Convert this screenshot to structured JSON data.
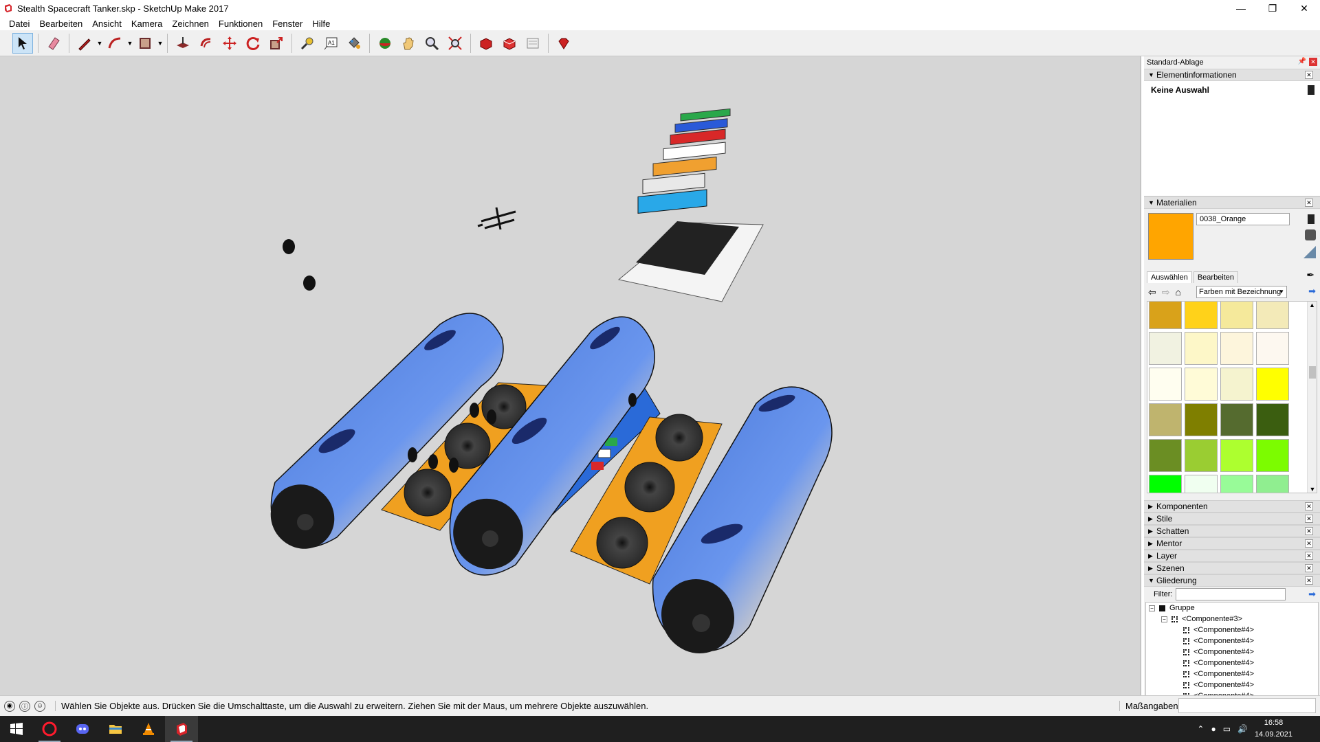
{
  "window": {
    "title": "Stealth Spacecraft Tanker.skp - SketchUp Make 2017",
    "app_icon": "sketchup-icon",
    "controls": {
      "minimize": "—",
      "maximize": "❐",
      "close": "✕"
    }
  },
  "menu": {
    "items": [
      "Datei",
      "Bearbeiten",
      "Ansicht",
      "Kamera",
      "Zeichnen",
      "Funktionen",
      "Fenster",
      "Hilfe"
    ]
  },
  "toolbar": {
    "tools": [
      {
        "name": "select-tool-icon",
        "glyph": "➤",
        "active": true
      },
      {
        "name": "eraser-tool-icon",
        "glyph": "▰"
      },
      {
        "name": "line-tool-icon",
        "glyph": "✎"
      },
      {
        "name": "arc-tool-icon",
        "glyph": "◜"
      },
      {
        "name": "rectangle-tool-icon",
        "glyph": "▭"
      },
      {
        "name": "push-pull-tool-icon",
        "glyph": "⬘"
      },
      {
        "name": "offset-tool-icon",
        "glyph": "↻"
      },
      {
        "name": "move-tool-icon",
        "glyph": "✥"
      },
      {
        "name": "rotate-tool-icon",
        "glyph": "⟳"
      },
      {
        "name": "scale-tool-icon",
        "glyph": "⬕"
      },
      {
        "name": "tape-measure-icon",
        "glyph": "📏"
      },
      {
        "name": "text-tool-icon",
        "glyph": "A"
      },
      {
        "name": "paint-bucket-icon",
        "glyph": "🎨"
      },
      {
        "name": "orbit-tool-icon",
        "glyph": "◔"
      },
      {
        "name": "pan-tool-icon",
        "glyph": "✋"
      },
      {
        "name": "zoom-tool-icon",
        "glyph": "🔍"
      },
      {
        "name": "zoom-extents-icon",
        "glyph": "⤧"
      },
      {
        "name": "warehouse-icon",
        "glyph": "◈"
      },
      {
        "name": "extension-warehouse-icon",
        "glyph": "◆"
      },
      {
        "name": "layout-icon",
        "glyph": "▤"
      },
      {
        "name": "ruby-icon",
        "glyph": "♦"
      }
    ]
  },
  "tray": {
    "title": "Standard-Ablage",
    "entity_info": {
      "header": "Elementinformationen",
      "selection": "Keine Auswahl"
    },
    "materials": {
      "header": "Materialien",
      "current_name": "0038_Orange",
      "current_color": "#ffa500",
      "tabs": [
        "Auswählen",
        "Bearbeiten"
      ],
      "library": "Farben mit Bezeichnung",
      "swatches": [
        "#d9a21a",
        "#ffd21a",
        "#f5e99b",
        "#f3eab8",
        "#f1f2e1",
        "#fdf7c8",
        "#fdf5dc",
        "#fdf8f0",
        "#fffef0",
        "#fffbd7",
        "#f5f3cf",
        "#ffff00",
        "#bfb46e",
        "#7f7f00",
        "#556b2f",
        "#3b5e10",
        "#6b8e23",
        "#9acd32",
        "#adff2f",
        "#7cfc00",
        "#00ff00",
        "#f0fff0",
        "#98fb98",
        "#90ee90"
      ]
    },
    "collapsed_panels": [
      "Komponenten",
      "Stile",
      "Schatten",
      "Mentor",
      "Layer",
      "Szenen"
    ],
    "outliner": {
      "header": "Gliederung",
      "filter_label": "Filter:",
      "root": "Gruppe",
      "child": "<Componente#3>",
      "leaves": [
        "<Componente#4>",
        "<Componente#4>",
        "<Componente#4>",
        "<Componente#4>",
        "<Componente#4>",
        "<Componente#4>",
        "<Componente#4>"
      ]
    }
  },
  "statusbar": {
    "hint": "Wählen Sie Objekte aus. Drücken Sie die Umschalttaste, um die Auswahl zu erweitern. Ziehen Sie mit der Maus, um mehrere Objekte auszuwählen.",
    "measurements_label": "Maßangaben",
    "measurements_value": ""
  },
  "taskbar": {
    "apps": [
      "start-icon",
      "opera-icon",
      "discord-icon",
      "file-explorer-icon",
      "vlc-icon",
      "sketchup-icon"
    ],
    "time": "16:58",
    "date": "14.09.2021"
  }
}
